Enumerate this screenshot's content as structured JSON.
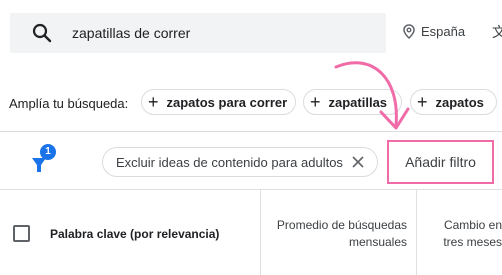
{
  "search": {
    "query": "zapatillas de correr",
    "location": "España",
    "language_partial": "文"
  },
  "broaden": {
    "label": "Amplía tu búsqueda:",
    "chips": [
      "zapatos para correr",
      "zapatillas",
      "zapatos"
    ]
  },
  "filters": {
    "badge_count": "1",
    "active_filter": "Excluir ideas de contenido para adultos",
    "add_filter_label": "Añadir filtro"
  },
  "table": {
    "headers": {
      "keyword": "Palabra clave (por relevancia)",
      "avg_searches_line1": "Promedio de búsquedas",
      "avg_searches_line2": "mensuales",
      "change_line1": "Cambio en",
      "change_line2": "tres meses"
    }
  },
  "colors": {
    "accent": "#1a73e8",
    "annotation": "#f06ba7"
  }
}
